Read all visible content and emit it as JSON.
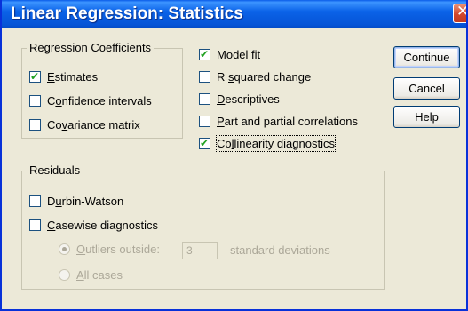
{
  "window": {
    "title": "Linear Regression: Statistics"
  },
  "regression_coefficients": {
    "title": "Regression Coefficients",
    "items": [
      {
        "pre": "",
        "mn": "E",
        "post": "stimates",
        "checked": true
      },
      {
        "pre": "C",
        "mn": "o",
        "post": "nfidence intervals",
        "checked": false
      },
      {
        "pre": "Co",
        "mn": "v",
        "post": "ariance matrix",
        "checked": false
      }
    ]
  },
  "options": [
    {
      "pre": "",
      "mn": "M",
      "post": "odel fit",
      "checked": true
    },
    {
      "pre": "R ",
      "mn": "s",
      "post": "quared change",
      "checked": false
    },
    {
      "pre": "",
      "mn": "D",
      "post": "escriptives",
      "checked": false
    },
    {
      "pre": "",
      "mn": "P",
      "post": "art and partial correlations",
      "checked": false
    },
    {
      "pre": "Co",
      "mn": "l",
      "post": "linearity diagnostics",
      "checked": true
    }
  ],
  "buttons": {
    "continue": "Continue",
    "cancel": "Cancel",
    "help": "Help"
  },
  "residuals": {
    "title": "Residuals",
    "durbin": {
      "pre": "D",
      "mn": "u",
      "post": "rbin-Watson",
      "checked": false
    },
    "casewise": {
      "pre": "",
      "mn": "C",
      "post": "asewise diagnostics",
      "checked": false
    },
    "outliers": {
      "pre": "",
      "mn": "O",
      "post": "utliers outside:",
      "selected": true,
      "value": "3",
      "suffix": "standard deviations"
    },
    "allcases": {
      "pre": "",
      "mn": "A",
      "post": "ll cases",
      "selected": false
    }
  },
  "colors": {
    "titlebar": "#0554d6",
    "dialog": "#ece9d8",
    "check": "#21a121",
    "disabled": "#aca899"
  }
}
